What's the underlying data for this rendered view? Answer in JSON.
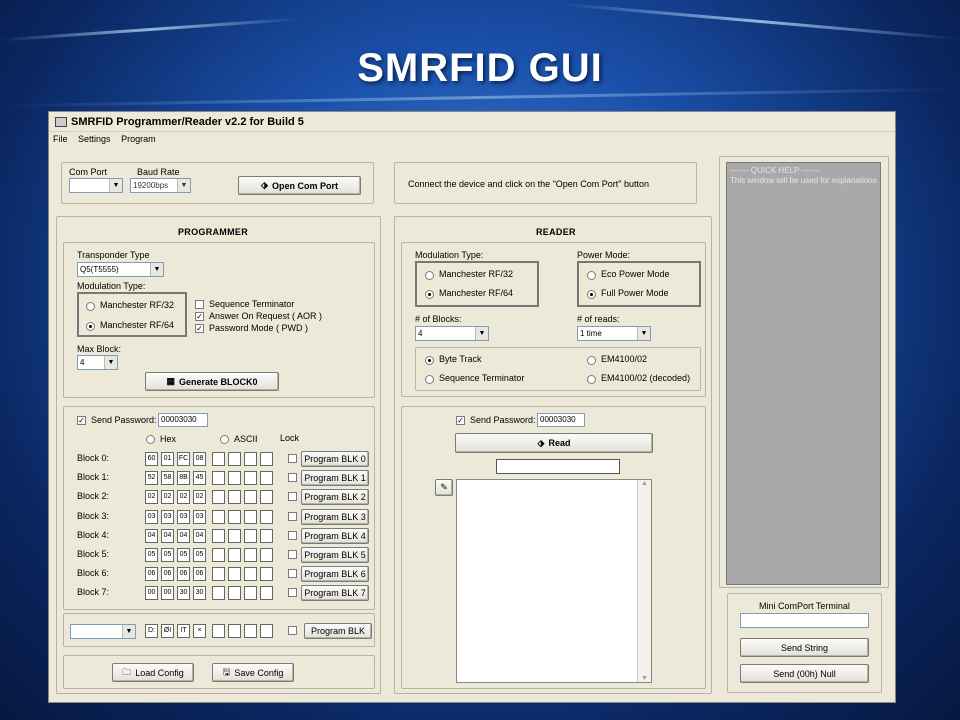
{
  "slide_title": "SMRFID GUI",
  "window": {
    "title": "SMRFID Programmer/Reader v2.2 for Build 5",
    "menu": [
      "File",
      "Settings",
      "Program"
    ]
  },
  "connection": {
    "com_port_label": "Com Port",
    "baud_rate_label": "Baud Rate",
    "com_port_value": "",
    "baud_rate_value": "19200bps",
    "open_button": "Open Com Port",
    "status_text": "Connect the device and click on the \"Open Com Port\" button"
  },
  "programmer": {
    "title": "PROGRAMMER",
    "transponder_type_label": "Transponder Type",
    "transponder_type_value": "Q5(T5555)",
    "modulation_label": "Modulation Type:",
    "mod_options": [
      "Manchester RF/32",
      "Manchester RF/64"
    ],
    "mod_selected": 1,
    "checkboxes": [
      {
        "label": "Sequence Terminator",
        "checked": false
      },
      {
        "label": "Answer On Request ( AOR )",
        "checked": true
      },
      {
        "label": "Password Mode ( PWD )",
        "checked": true
      }
    ],
    "max_block_label": "Max Block:",
    "max_block_value": "4",
    "generate_button": "Generate BLOCK0",
    "send_password_label": "Send Password:",
    "send_password_checked": true,
    "send_password_value": "00003030",
    "hex_label": "Hex",
    "ascii_label": "ASCII",
    "lock_label": "Lock",
    "blocks": [
      {
        "label": "Block 0:",
        "bytes": [
          "60",
          "01",
          "FC",
          "08"
        ],
        "button": "Program BLK 0"
      },
      {
        "label": "Block 1:",
        "bytes": [
          "52",
          "58",
          "8B",
          "45"
        ],
        "button": "Program BLK 1"
      },
      {
        "label": "Block 2:",
        "bytes": [
          "02",
          "02",
          "02",
          "02"
        ],
        "button": "Program BLK 2"
      },
      {
        "label": "Block 3:",
        "bytes": [
          "03",
          "03",
          "03",
          "03"
        ],
        "button": "Program BLK 3"
      },
      {
        "label": "Block 4:",
        "bytes": [
          "04",
          "04",
          "04",
          "04"
        ],
        "button": "Program BLK 4"
      },
      {
        "label": "Block 5:",
        "bytes": [
          "05",
          "05",
          "05",
          "05"
        ],
        "button": "Program BLK 5"
      },
      {
        "label": "Block 6:",
        "bytes": [
          "06",
          "06",
          "06",
          "06"
        ],
        "button": "Program BLK 6"
      },
      {
        "label": "Block 7:",
        "bytes": [
          "00",
          "00",
          "30",
          "30"
        ],
        "button": "Program BLK 7"
      }
    ],
    "custom_block_bytes": [
      "D:",
      "ØI",
      "IT",
      "×"
    ],
    "custom_program_button": "Program BLK",
    "load_config": "Load Config",
    "save_config": "Save Config"
  },
  "reader": {
    "title": "READER",
    "modulation_label": "Modulation Type:",
    "mod_options": [
      "Manchester RF/32",
      "Manchester RF/64"
    ],
    "mod_selected": 1,
    "power_label": "Power Mode:",
    "power_options": [
      "Eco Power Mode",
      "Full Power Mode"
    ],
    "power_selected": 1,
    "blocks_label": "# of Blocks:",
    "blocks_value": "4",
    "reads_label": "# of reads:",
    "reads_value": "1 time",
    "format_options": [
      "Byte Track",
      "Sequence Terminator",
      "EM4100/02",
      "EM4100/02 (decoded)"
    ],
    "format_selected": 0,
    "send_password_label": "Send Password:",
    "send_password_checked": true,
    "send_password_value": "00003030",
    "read_button": "Read",
    "result_value": ""
  },
  "help": {
    "text": "------- QUICK HELP -------\nThis window will be used for explanations"
  },
  "terminal": {
    "title": "Mini ComPort Terminal",
    "input_value": "",
    "send_string": "Send String",
    "send_null": "Send (00h) Null"
  },
  "colors": {
    "window_bg": "#ece9d8",
    "help_bg": "#a9a9a9",
    "slide_bg": "#1a4fa8"
  }
}
